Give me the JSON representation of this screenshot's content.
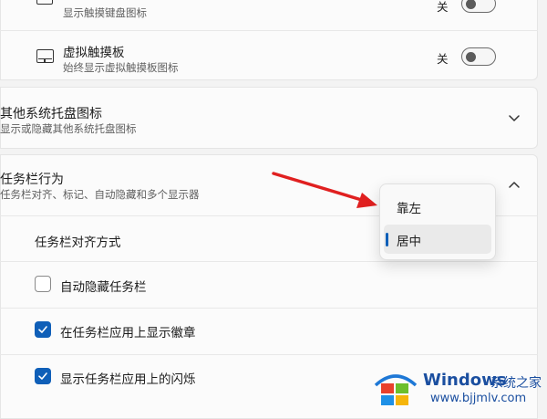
{
  "toggles": [
    {
      "title": "",
      "subtitle": "显示触摸键盘图标",
      "state_label": "关"
    },
    {
      "title": "虚拟触摸板",
      "subtitle": "始终显示虚拟触摸板图标",
      "state_label": "关"
    }
  ],
  "sections": {
    "other_tray": {
      "title": "其他系统托盘图标",
      "subtitle": "显示或隐藏其他系统托盘图标"
    },
    "taskbar_behavior": {
      "title": "任务栏行为",
      "subtitle": "任务栏对齐、标记、自动隐藏和多个显示器"
    }
  },
  "alignment": {
    "label": "任务栏对齐方式"
  },
  "options": [
    {
      "label": "自动隐藏任务栏",
      "checked": false
    },
    {
      "label": "在任务栏应用上显示徽章",
      "checked": true
    },
    {
      "label": "显示任务栏应用上的闪烁",
      "checked": true
    }
  ],
  "dropdown": {
    "items": [
      {
        "label": "靠左",
        "selected": false
      },
      {
        "label": "居中",
        "selected": true
      }
    ]
  },
  "watermark": {
    "brand": "Windows",
    "site_name": "系统之家",
    "url": "www.bjjmlv.com"
  },
  "colors": {
    "accent": "#0f5fb8",
    "arrow": "#e02020"
  }
}
